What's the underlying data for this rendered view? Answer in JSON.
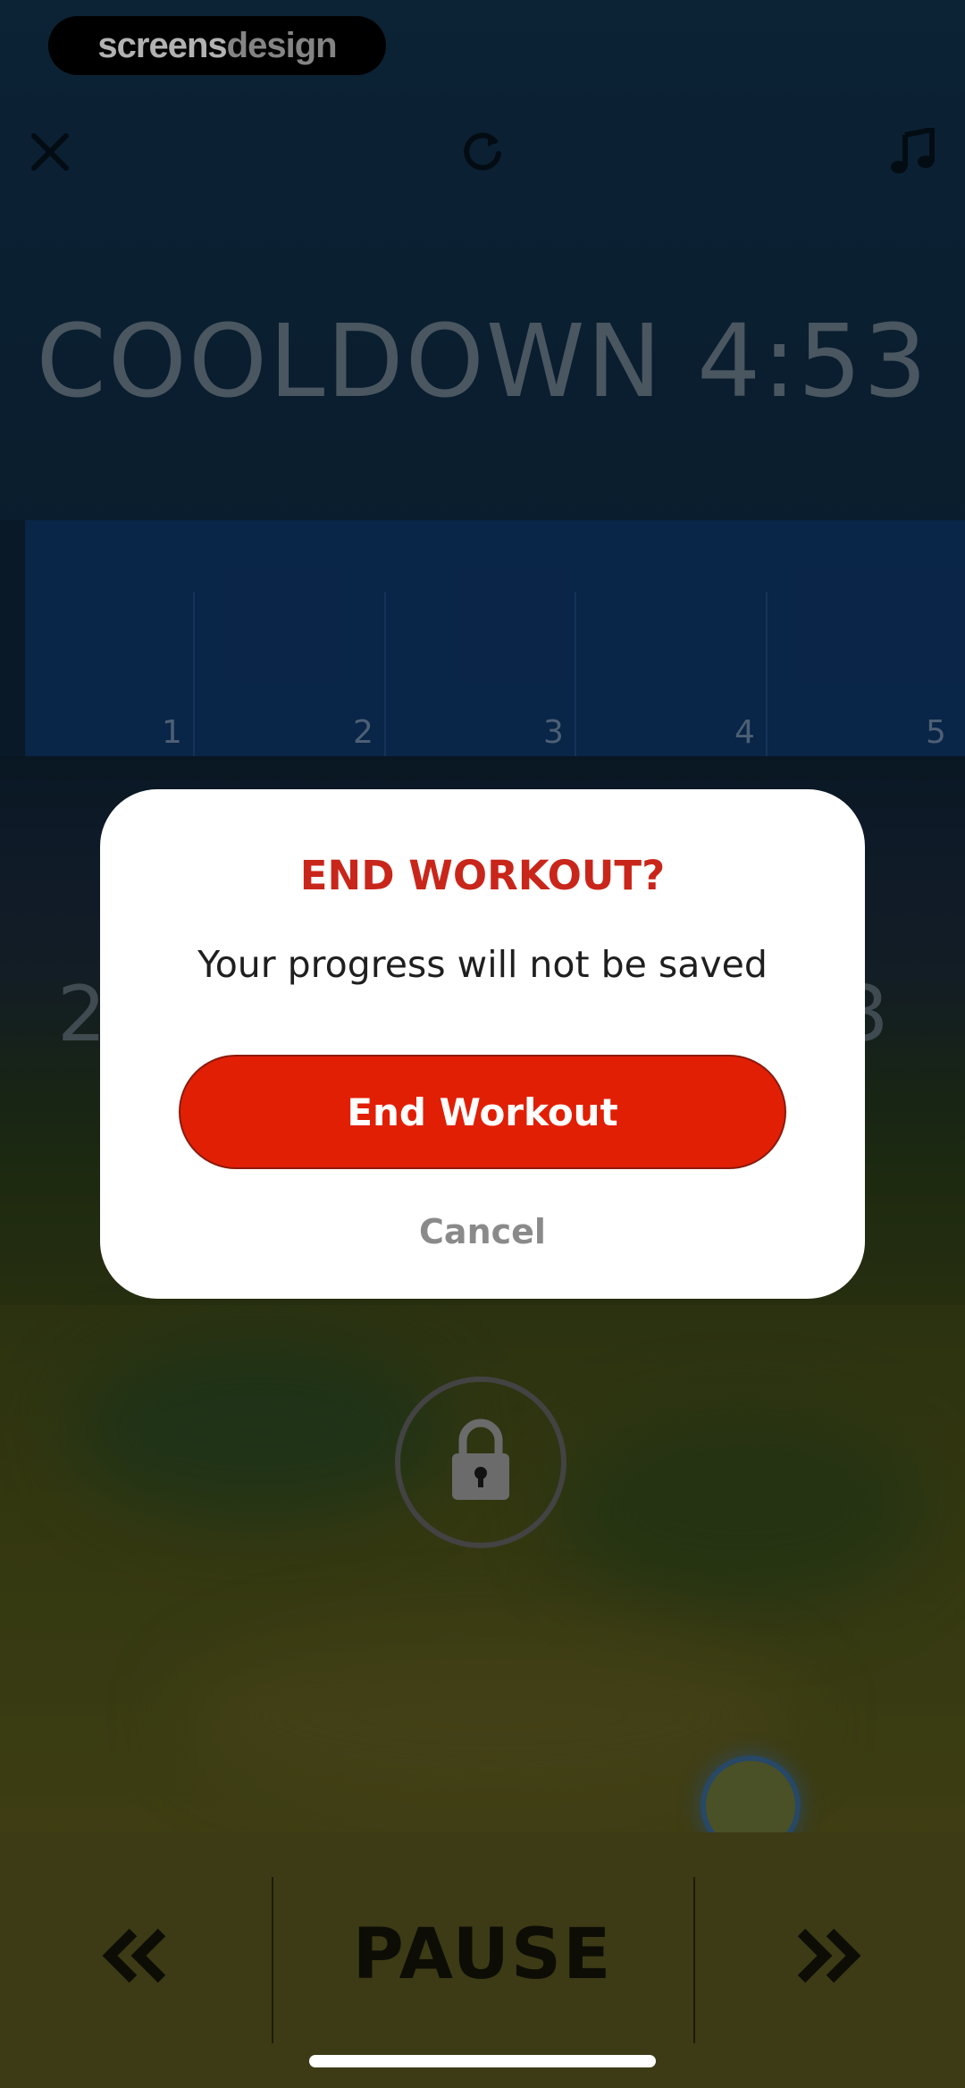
{
  "watermark": {
    "brand_primary": "screens",
    "brand_secondary": "design"
  },
  "workout": {
    "timer_label": "COOLDOWN 4:53",
    "zones": [
      "1",
      "2",
      "3",
      "4",
      "5"
    ],
    "side_left": "2",
    "side_right": "3"
  },
  "controls": {
    "pause_label": "PAUSE",
    "prev_icon": "double-chevron-left-icon",
    "next_icon": "double-chevron-right-icon"
  },
  "dialog": {
    "title": "END WORKOUT?",
    "message": "Your progress will not be saved",
    "confirm_label": "End Workout",
    "cancel_label": "Cancel"
  },
  "colors": {
    "accent_red": "#e11f05",
    "title_red": "#c9261b",
    "zone_blue": "#0e3566"
  }
}
